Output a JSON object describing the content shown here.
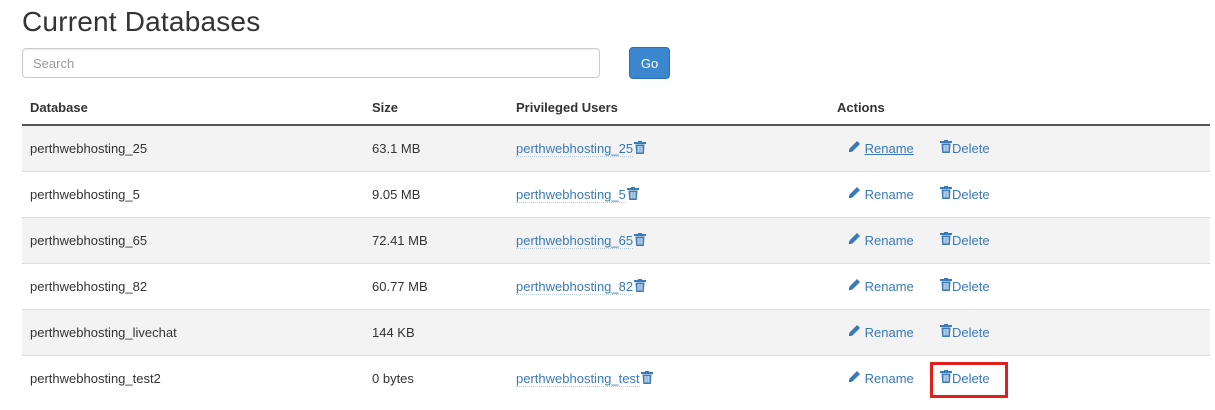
{
  "page": {
    "title": "Current Databases"
  },
  "search": {
    "placeholder": "Search",
    "go_label": "Go"
  },
  "table": {
    "headers": {
      "database": "Database",
      "size": "Size",
      "users": "Privileged Users",
      "actions": "Actions"
    },
    "action_labels": {
      "rename": "Rename",
      "delete": "Delete"
    },
    "rows": [
      {
        "database": "perthwebhosting_25",
        "size": "63.1 MB",
        "user": "perthwebhosting_25"
      },
      {
        "database": "perthwebhosting_5",
        "size": "9.05 MB",
        "user": "perthwebhosting_5"
      },
      {
        "database": "perthwebhosting_65",
        "size": "72.41 MB",
        "user": "perthwebhosting_65"
      },
      {
        "database": "perthwebhosting_82",
        "size": "60.77 MB",
        "user": "perthwebhosting_82"
      },
      {
        "database": "perthwebhosting_livechat",
        "size": "144 KB",
        "user": ""
      },
      {
        "database": "perthwebhosting_test2",
        "size": "0 bytes",
        "user": "perthwebhosting_test"
      }
    ]
  },
  "colors": {
    "link": "#3a7ab8",
    "button": "#3a87cf",
    "highlight": "#e0201c"
  },
  "icons": {
    "rename": "pencil-icon",
    "delete": "trash-icon"
  }
}
